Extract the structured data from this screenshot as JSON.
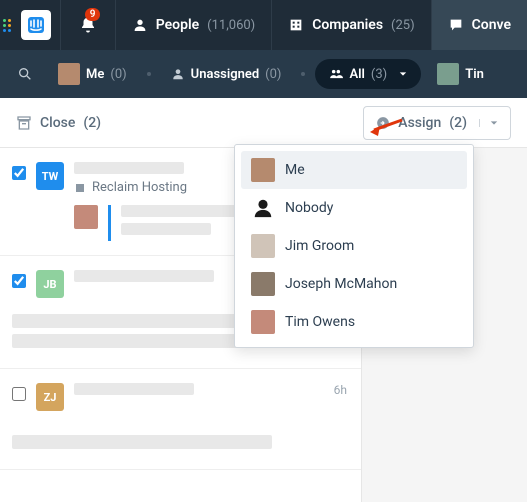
{
  "topnav": {
    "bell_badge": "9",
    "people_label": "People",
    "people_count": "(11,060)",
    "companies_label": "Companies",
    "companies_count": "(25)",
    "conv_label": "Conve"
  },
  "subnav": {
    "me_label": "Me",
    "me_count": "(0)",
    "unassigned_label": "Unassigned",
    "unassigned_count": "(0)",
    "all_label": "All",
    "all_count": "(3)",
    "extra_label": "Tin"
  },
  "toolbar": {
    "close_label": "Close",
    "close_count": "(2)",
    "assign_label": "Assign",
    "assign_count": "(2)"
  },
  "assign_menu": [
    {
      "label": "Me"
    },
    {
      "label": "Nobody"
    },
    {
      "label": "Jim Groom"
    },
    {
      "label": "Joseph McMahon"
    },
    {
      "label": "Tim Owens"
    }
  ],
  "rows": [
    {
      "initials": "TW",
      "company": "Reclaim Hosting",
      "checked": true
    },
    {
      "initials": "JB",
      "checked": true
    },
    {
      "initials": "ZJ",
      "checked": false,
      "time": "6h"
    }
  ]
}
